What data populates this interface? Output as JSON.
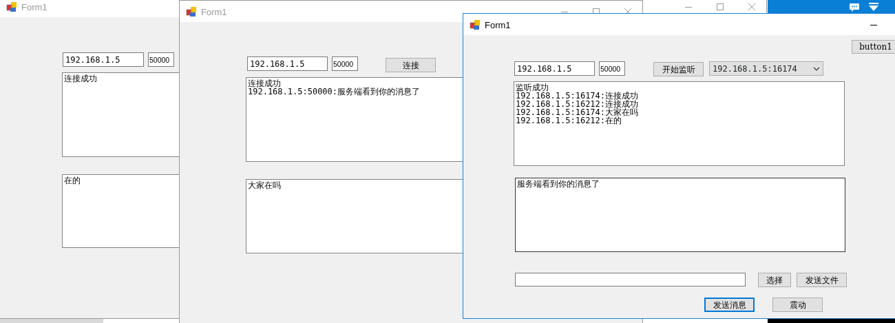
{
  "windows": [
    {
      "title": "Form1",
      "active": false,
      "controls": [
        {
          "kind": "textbox",
          "value": "192.168.1.5"
        },
        {
          "kind": "textbox",
          "value": "50000"
        },
        {
          "kind": "memo",
          "lines": [
            "连接成功"
          ]
        },
        {
          "kind": "memo",
          "lines": [
            "在的"
          ]
        }
      ]
    },
    {
      "title": "Form1",
      "active": false,
      "controls": [
        {
          "kind": "textbox",
          "value": "192.168.1.5"
        },
        {
          "kind": "textbox",
          "value": "50000"
        },
        {
          "kind": "button",
          "label": "连接",
          "focused": false
        },
        {
          "kind": "memo",
          "lines": [
            "连接成功",
            "192.168.1.5:50000:服务端看到你的消息了"
          ]
        },
        {
          "kind": "memo",
          "lines": [
            "大家在吗"
          ]
        }
      ]
    },
    {
      "title": "Form1",
      "active": true,
      "controls": [
        {
          "kind": "button",
          "label": "button1",
          "focused": false
        },
        {
          "kind": "textbox",
          "value": "192.168.1.5"
        },
        {
          "kind": "textbox",
          "value": "50000"
        },
        {
          "kind": "button",
          "label": "开始监听",
          "focused": false
        },
        {
          "kind": "combo",
          "value": "192.168.1.5:16174"
        },
        {
          "kind": "memo",
          "lines": [
            "监听成功",
            "192.168.1.5:16174:连接成功",
            "192.168.1.5:16212:连接成功",
            "192.168.1.5:16174:大家在吗",
            "192.168.1.5:16212:在的"
          ]
        },
        {
          "kind": "memo",
          "lines": [
            "服务端看到你的消息了"
          ]
        },
        {
          "kind": "textbox"
        },
        {
          "kind": "button",
          "label": "选择",
          "focused": false
        },
        {
          "kind": "button",
          "label": "发送文件",
          "focused": false
        },
        {
          "kind": "button",
          "label": "发送消息",
          "focused": true
        },
        {
          "kind": "button",
          "label": "震动",
          "focused": false
        }
      ]
    }
  ]
}
